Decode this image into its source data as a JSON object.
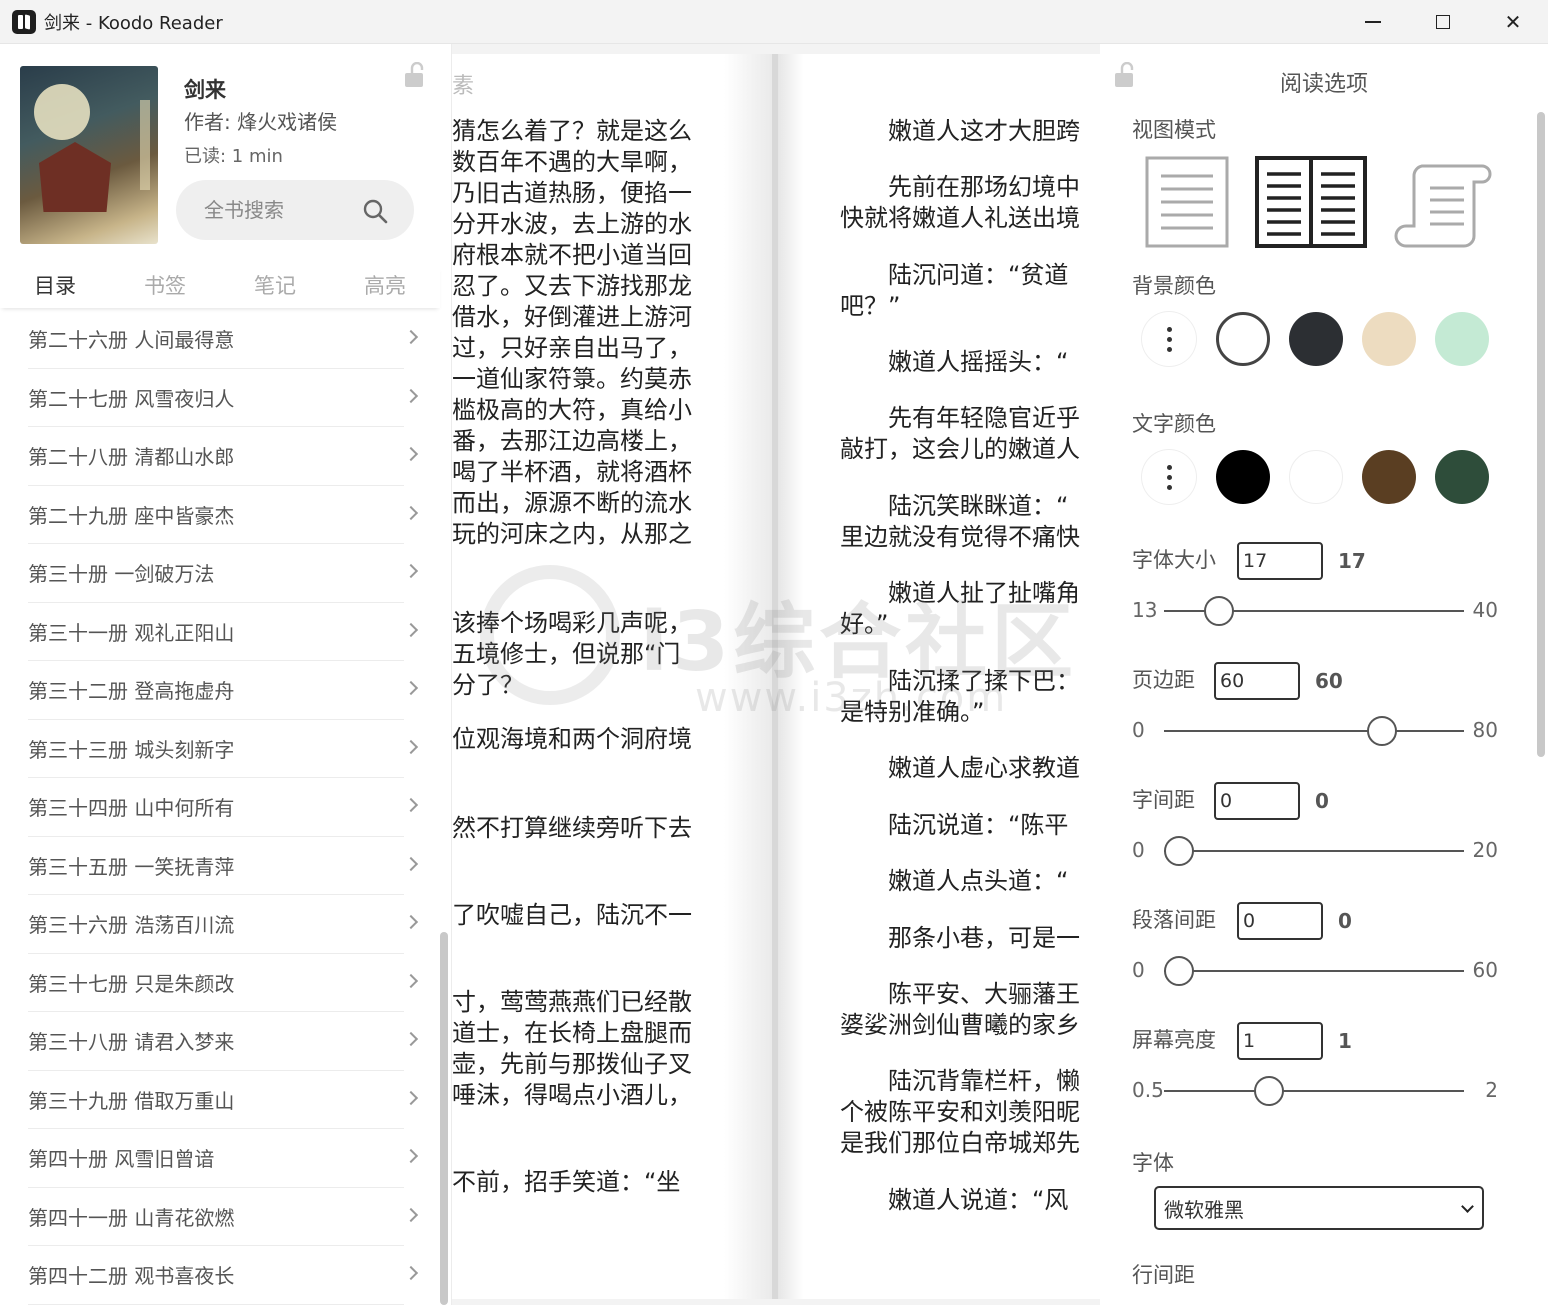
{
  "window": {
    "title": "剑来 - Koodo Reader",
    "minimize_glyph": "",
    "close_glyph": "✕"
  },
  "book": {
    "title": "剑来",
    "author": "作者: 烽火戏诸侯",
    "read": "已读: 1  min",
    "search_placeholder": "全书搜索"
  },
  "tabs": [
    {
      "label": "目录",
      "active": true
    },
    {
      "label": "书签",
      "active": false
    },
    {
      "label": "笔记",
      "active": false
    },
    {
      "label": "高亮",
      "active": false
    }
  ],
  "toc": [
    "第二十六册 人间最得意",
    "第二十七册 风雪夜归人",
    "第二十八册 清都山水郎",
    "第二十九册 座中皆豪杰",
    "第三十册 一剑破万法",
    "第三十一册 观礼正阳山",
    "第三十二册 登高拖虚舟",
    "第三十三册 城头刻新字",
    "第三十四册 山中何所有",
    "第三十五册 一笑抚青萍",
    "第三十六册 浩荡百川流",
    "第三十七册 只是朱颜改",
    "第三十八册 请君入梦来",
    "第三十九册 借取万重山",
    "第四十册 风雪旧曾谙",
    "第四十一册 山青花欲燃",
    "第四十二册 观书喜夜长"
  ],
  "reader": {
    "left_header": "素",
    "left_page": [
      "猜怎么着了？就是这么\n数百年不遇的大旱啊，\n乃旧古道热肠，便掐一\n分开水波，去上游的水\n府根本就不把小道当回\n忍了。又去下游找那龙\n借水，好倒灌进上游河\n过，只好亲自出马了，\n一道仙家符箓。约莫赤\n槛极高的大符，真给小\n番，去那江边高楼上，\n喝了半杯酒，就将酒杯\n而出，源源不断的流水\n玩的河床之内，从那之",
      "该捧个场喝彩几声呢，\n五境修士，但说那“门\n分了？",
      "位观海境和两个洞府境",
      "然不打算继续旁听下去",
      "了吹嘘自己，陆沉不一",
      "寸，莺莺燕燕们已经散\n道士，在长椅上盘腿而\n壶，先前与那拨仙子叉\n唾沫，得喝点小酒儿，",
      "不前，招手笑道：“坐"
    ],
    "right_page": [
      "　　嫩道人这才大胆跨",
      "　　先前在那场幻境中\n快就将嫩道人礼送出境",
      "　　陆沉问道：“贫道\n吧？”",
      "　　嫩道人摇摇头：“",
      "　　先有年轻隐官近乎\n敲打，这会儿的嫩道人",
      "　　陆沉笑眯眯道：“\n里边就没有觉得不痛快",
      "　　嫩道人扯了扯嘴角\n好。”",
      "　　陆沉揉了揉下巴：\n是特别准确。”",
      "　　嫩道人虚心求教道",
      "　　陆沉说道：“陈平",
      "　　嫩道人点头道：“",
      "　　那条小巷，可是一",
      "　　陈平安、大骊藩王\n婆娑洲剑仙曹曦的家乡",
      "　　陆沉背靠栏杆，懒\n个被陈平安和刘羡阳昵\n是我们那位白帝城郑先",
      "　　嫩道人说道：“风"
    ],
    "watermark_text": "i3综合社区",
    "watermark_url": "www.i3zh.com"
  },
  "options": {
    "title": "阅读选项",
    "view_mode_label": "视图模式",
    "view_modes": [
      "single-page",
      "double-page",
      "scroll"
    ],
    "view_mode_selected": "double-page",
    "bg_color_label": "背景颜色",
    "bg_colors": [
      "#ffffff",
      "#2c2f33",
      "#eddcc0",
      "#c4ead4"
    ],
    "text_color_label": "文字颜色",
    "text_colors": [
      "#000000",
      "#ffffff",
      "#5a3e22",
      "#2e4d3a"
    ],
    "sliders": [
      {
        "label": "字体大小",
        "input": "17",
        "value": "17",
        "min": "13",
        "max": "40",
        "num": 17,
        "lo": 13,
        "hi": 40
      },
      {
        "label": "页边距",
        "input": "60",
        "value": "60",
        "min": "0",
        "max": "80",
        "num": 60,
        "lo": 0,
        "hi": 80
      },
      {
        "label": "字间距",
        "input": "0",
        "value": "0",
        "min": "0",
        "max": "20",
        "num": 0,
        "lo": 0,
        "hi": 20
      },
      {
        "label": "段落间距",
        "input": "0",
        "value": "0",
        "min": "0",
        "max": "60",
        "num": 0,
        "lo": 0,
        "hi": 60
      },
      {
        "label": "屏幕亮度",
        "input": "1",
        "value": "1",
        "min": "0.5",
        "max": "2",
        "num": 1,
        "lo": 0.5,
        "hi": 2
      }
    ],
    "font_label": "字体",
    "font_value": "微软雅黑",
    "line_height_label": "行间距"
  }
}
